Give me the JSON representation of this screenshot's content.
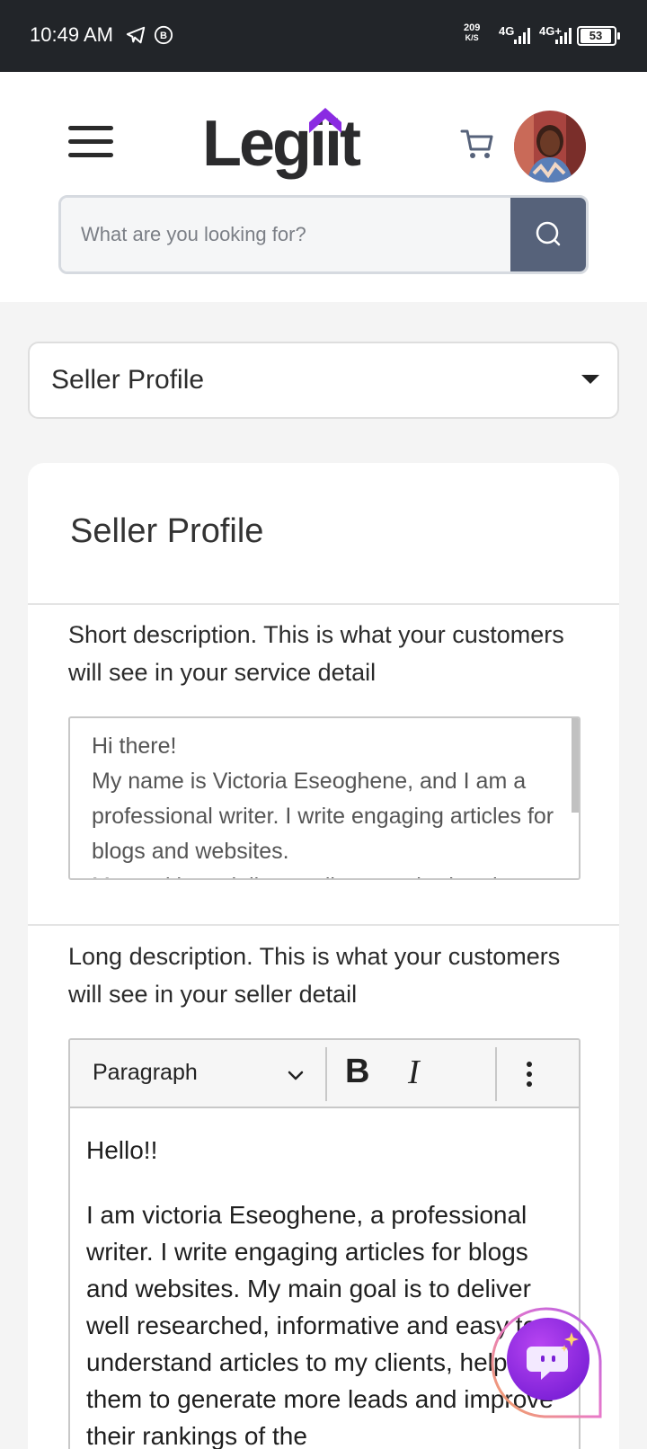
{
  "status_bar": {
    "time": "10:49 AM",
    "net_speed_value": "209",
    "net_speed_unit": "K/S",
    "signal_1": "4G",
    "signal_2": "4G+",
    "battery": "53",
    "icons": [
      "telegram-icon",
      "blogger-icon",
      "signal-icon",
      "battery-icon"
    ]
  },
  "header": {
    "logo_text": "Legiit",
    "brand_color": "#8a2be2",
    "search_placeholder": "What are you looking for?",
    "search_accent": "#56627a"
  },
  "section_select": {
    "value": "Seller Profile"
  },
  "card": {
    "title": "Seller Profile",
    "short_description": {
      "label": "Short description. This is what your customers will see in your service detail",
      "value": "Hi there!\nMy name is Victoria Eseoghene, and I am a professional writer. I write engaging articles for blogs and websites.\nMy goal is to deliver well researched and"
    },
    "long_description": {
      "label": "Long description. This is what your customers will see in your seller detail",
      "toolbar": {
        "paragraph_label": "Paragraph",
        "bold_label": "B",
        "italic_label": "I"
      },
      "paragraphs": [
        "Hello!!",
        "I am victoria Eseoghene, a professional writer. I write engaging articles for blogs and websites. My main goal is to deliver well researched, informative and easy to understand articles to my clients, helping them to generate more leads and improve their rankings of the"
      ]
    }
  }
}
